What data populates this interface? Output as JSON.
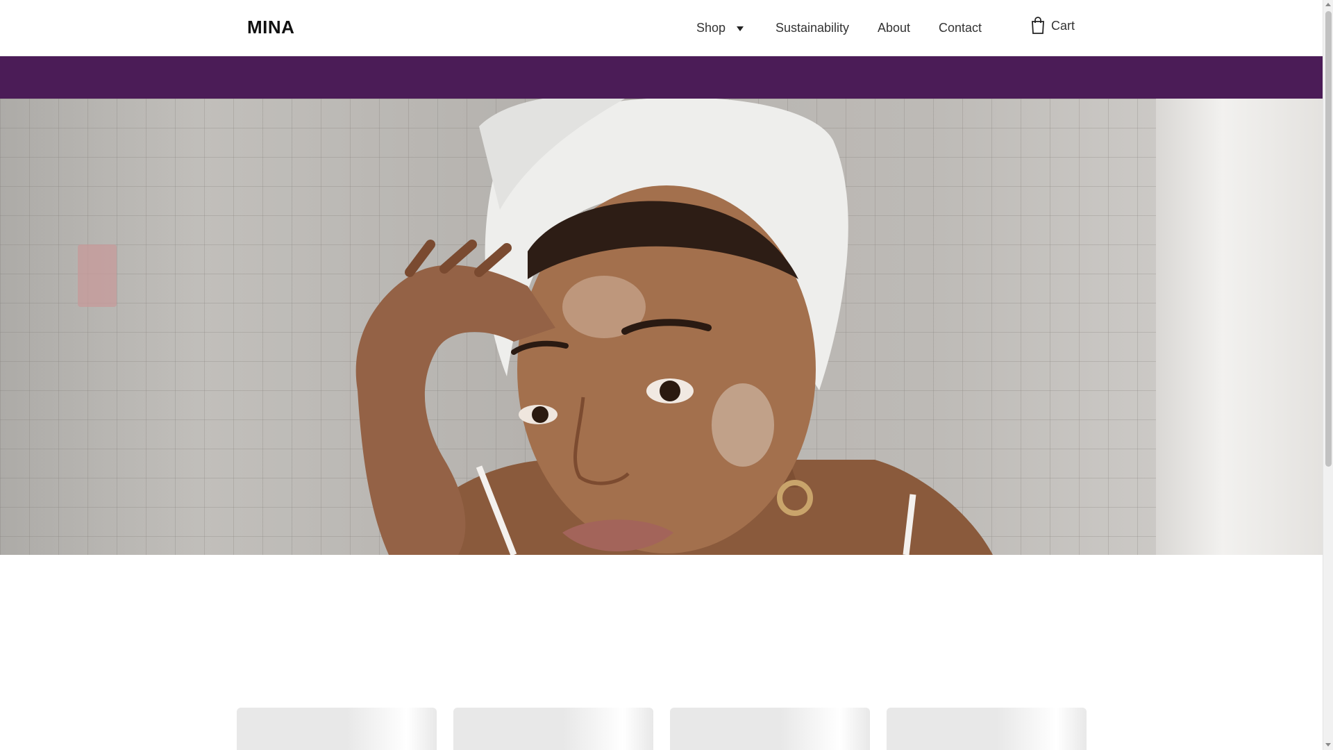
{
  "brand": {
    "logo_text": "MINA"
  },
  "nav": {
    "items": [
      {
        "label": "Shop",
        "has_dropdown": true
      },
      {
        "label": "Sustainability"
      },
      {
        "label": "About"
      },
      {
        "label": "Contact"
      }
    ],
    "cart_label": "Cart",
    "cart_icon": "shopping-bag-icon"
  },
  "promo_bar": {
    "color": "#4b1c57"
  },
  "hero": {
    "image": "woman-applying-face-cream-photo"
  },
  "product_cards": {
    "count_visible": 4,
    "state": "loading-placeholder"
  },
  "colors": {
    "accent": "#4b1c57",
    "background": "#ffffff",
    "text": "#222222"
  }
}
